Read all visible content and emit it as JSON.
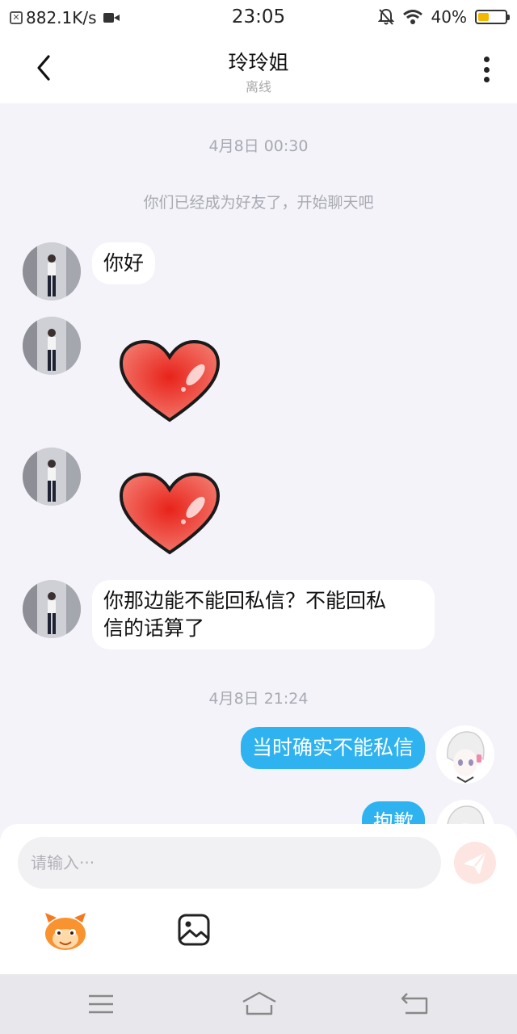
{
  "status_bar": {
    "speed": "882.1K/s",
    "time": "23:05",
    "battery_percent": "40%",
    "battery_level": 0.4,
    "icons": [
      "notification-box-icon",
      "video-camera-icon",
      "bell-off-icon",
      "wifi-icon",
      "battery-icon"
    ]
  },
  "header": {
    "title": "玲玲姐",
    "subtitle": "离线",
    "icons": [
      "back-arrow-icon",
      "more-vertical-icon"
    ]
  },
  "chat": {
    "timestamp_1": "4月8日 00:30",
    "system_message": "你们已经成为好友了，开始聊天吧",
    "msg_1": "你好",
    "msg_2_sticker": "heart-sticker",
    "msg_3_sticker": "heart-sticker",
    "msg_4_line_1": "你那边能不能回私信？不能回私",
    "msg_4_line_2": "信的话算了",
    "timestamp_2": "4月8日 21:24",
    "msg_5": "当时确实不能私信",
    "msg_6": "抱歉"
  },
  "composer": {
    "placeholder": "请输入···",
    "icons": [
      "send-icon",
      "emoji-sticker-icon",
      "image-icon"
    ]
  },
  "nav_bar": {
    "icons": [
      "menu-icon",
      "home-icon",
      "back-icon"
    ]
  },
  "colors": {
    "outgoing_bubble": "#2fb2f0",
    "incoming_bubble": "#ffffff",
    "background": "#f3f3f9",
    "send_button": "#fde5e1",
    "battery": "#f5b800"
  }
}
